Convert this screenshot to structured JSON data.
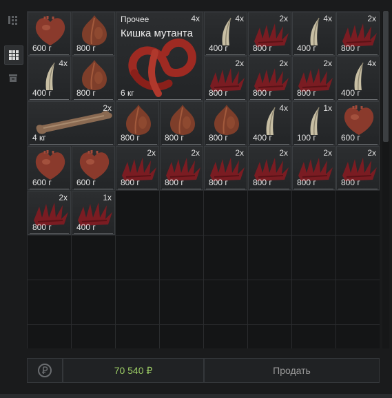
{
  "sidebar": {
    "icons": [
      "sort-icon",
      "grid-view-icon",
      "box-icon"
    ]
  },
  "items": [
    {
      "icon": "heart",
      "amount": "600 г",
      "count": ""
    },
    {
      "icon": "onion",
      "amount": "800 г",
      "count": ""
    },
    {
      "icon": "tentacle",
      "amount": "6 кг",
      "count": "4x",
      "category": "Прочее",
      "name": "Кишка мутанта"
    },
    {
      "icon": "claw",
      "amount": "400 г",
      "count": "4x"
    },
    {
      "icon": "spike",
      "amount": "800 г",
      "count": "2x"
    },
    {
      "icon": "claw",
      "amount": "400 г",
      "count": "4x"
    },
    {
      "icon": "spike",
      "amount": "800 г",
      "count": "2x"
    },
    {
      "icon": "claw",
      "amount": "400 г",
      "count": "4x"
    },
    {
      "icon": "onion",
      "amount": "800 г",
      "count": ""
    },
    {
      "icon": "spike",
      "amount": "800 г",
      "count": "2x"
    },
    {
      "icon": "spike",
      "amount": "800 г",
      "count": "2x"
    },
    {
      "icon": "spike",
      "amount": "800 г",
      "count": "2x"
    },
    {
      "icon": "claw",
      "amount": "400 г",
      "count": "4x"
    },
    {
      "icon": "bone",
      "amount": "4 кг",
      "count": "2x"
    },
    {
      "icon": "onion",
      "amount": "800 г",
      "count": ""
    },
    {
      "icon": "onion",
      "amount": "800 г",
      "count": ""
    },
    {
      "icon": "onion",
      "amount": "800 г",
      "count": ""
    },
    {
      "icon": "claw",
      "amount": "400 г",
      "count": "4x"
    },
    {
      "icon": "claw",
      "amount": "100 г",
      "count": "1x"
    },
    {
      "icon": "heart",
      "amount": "600 г",
      "count": ""
    },
    {
      "icon": "heart",
      "amount": "600 г",
      "count": ""
    },
    {
      "icon": "heart",
      "amount": "600 г",
      "count": ""
    },
    {
      "icon": "spike",
      "amount": "800 г",
      "count": "2x"
    },
    {
      "icon": "spike",
      "amount": "800 г",
      "count": "2x"
    },
    {
      "icon": "spike",
      "amount": "800 г",
      "count": "2x"
    },
    {
      "icon": "spike",
      "amount": "800 г",
      "count": "2x"
    },
    {
      "icon": "spike",
      "amount": "800 г",
      "count": "2x"
    },
    {
      "icon": "spike",
      "amount": "800 г",
      "count": "2x"
    },
    {
      "icon": "spike",
      "amount": "800 г",
      "count": "2x"
    },
    {
      "icon": "spike",
      "amount": "400 г",
      "count": "1x"
    }
  ],
  "footer": {
    "total": "70 540 ₽",
    "sell_label": "Продать",
    "reset_icon": "ruble-refresh-icon"
  }
}
